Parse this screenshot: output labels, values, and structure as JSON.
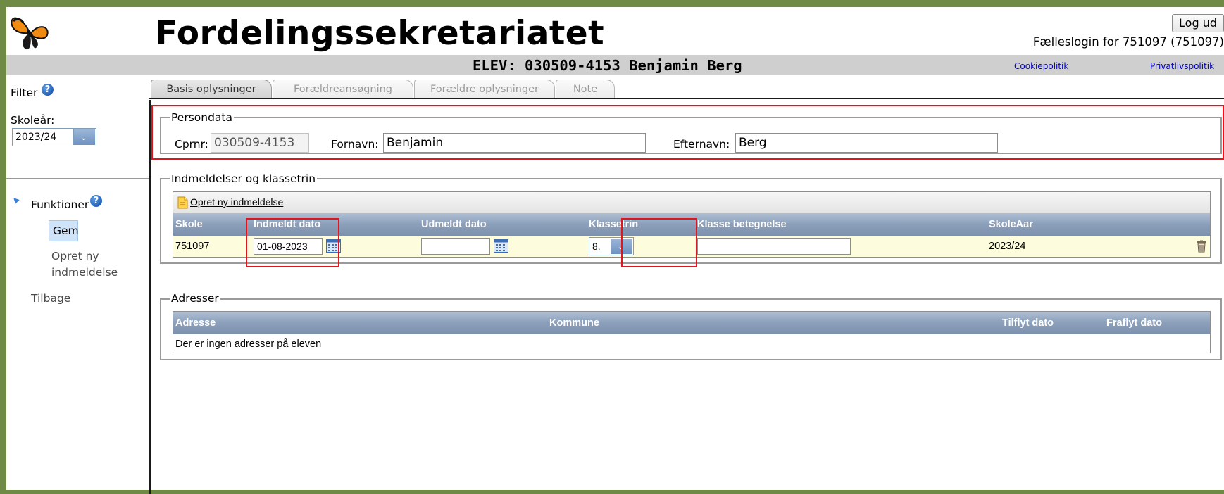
{
  "header": {
    "app_title": "Fordelingssekretariatet",
    "logout_label": "Log ud",
    "login_info": "Fælleslogin for 751097 (751097)",
    "student_title": "ELEV: 030509-4153 Benjamin Berg",
    "cookie_link": "Cookiepolitik",
    "privacy_link": "Privatlivspolitik"
  },
  "sidebar": {
    "filter_label": "Filter",
    "schoolyear_label": "Skoleår:",
    "schoolyear_value": "2023/24",
    "functions_label": "Funktioner",
    "save_label": "Gem",
    "new_enrollment_line1": "Opret ny",
    "new_enrollment_line2": "indmeldelse",
    "back_label": "Tilbage"
  },
  "tabs": [
    {
      "label": "Basis oplysninger",
      "active": true
    },
    {
      "label": "Forældreansøgning",
      "active": false
    },
    {
      "label": "Forældre oplysninger",
      "active": false
    },
    {
      "label": "Note",
      "active": false
    }
  ],
  "persondata": {
    "legend": "Persondata",
    "cpr_label": "Cprnr:",
    "cpr_value": "030509-4153",
    "firstname_label": "Fornavn:",
    "firstname_value": "Benjamin",
    "lastname_label": "Efternavn:",
    "lastname_value": "Berg"
  },
  "enrollments": {
    "legend": "Indmeldelser og klassetrin",
    "new_link": "Opret ny indmeldelse",
    "columns": [
      "Skole",
      "Indmeldt dato",
      "Udmeldt dato",
      "Klassetrin",
      "Klasse betegnelse",
      "SkoleAar"
    ],
    "row": {
      "school": "751097",
      "enrolled_date": "01-08-2023",
      "withdrawn_date": "",
      "grade": "8.",
      "class_name": "",
      "school_year": "2023/24"
    }
  },
  "addresses": {
    "legend": "Adresser",
    "columns": [
      "Adresse",
      "Kommune",
      "Tilflyt dato",
      "Fraflyt dato"
    ],
    "empty_text": "Der er ingen adresser på eleven"
  },
  "colors": {
    "highlight": "#e0161e",
    "grid_header": "#8b9fbb",
    "row_highlight": "#fdfcdc",
    "background_frame": "#6e8a45"
  }
}
